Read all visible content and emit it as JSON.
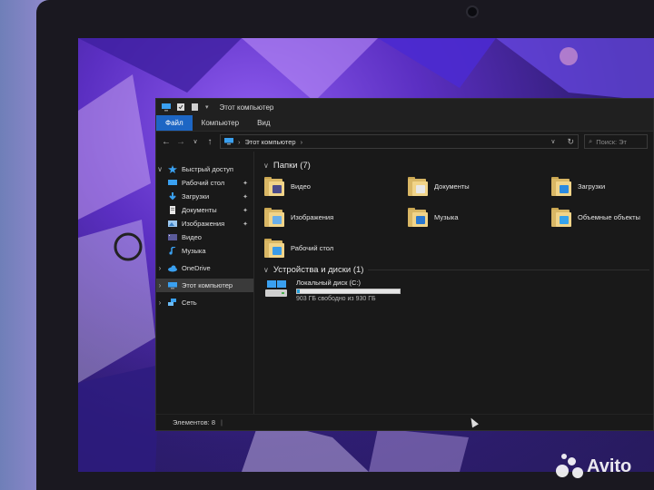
{
  "window": {
    "title": "Этот компьютер"
  },
  "ribbon": {
    "tabs": [
      "Файл",
      "Компьютер",
      "Вид"
    ],
    "active_tab": 0
  },
  "address": {
    "path": "Этот компьютер",
    "search_placeholder": "Поиск: Эт"
  },
  "nav": {
    "items": [
      {
        "label": "Быстрый доступ",
        "icon": "star-icon",
        "pinned": false
      },
      {
        "label": "Рабочий стол",
        "icon": "desktop-icon",
        "pinned": true
      },
      {
        "label": "Загрузки",
        "icon": "download-icon",
        "pinned": true
      },
      {
        "label": "Документы",
        "icon": "document-icon",
        "pinned": true
      },
      {
        "label": "Изображения",
        "icon": "pictures-icon",
        "pinned": true
      },
      {
        "label": "Видео",
        "icon": "video-icon",
        "pinned": false
      },
      {
        "label": "Музыка",
        "icon": "music-icon",
        "pinned": false
      },
      {
        "label": "OneDrive",
        "icon": "cloud-icon",
        "pinned": false
      },
      {
        "label": "Этот компьютер",
        "icon": "computer-icon",
        "pinned": false
      },
      {
        "label": "Сеть",
        "icon": "network-icon",
        "pinned": false
      }
    ]
  },
  "folders": {
    "header": "Папки (7)",
    "items": [
      {
        "label": "Видео",
        "icon": "video-folder-icon"
      },
      {
        "label": "Документы",
        "icon": "documents-folder-icon"
      },
      {
        "label": "Загрузки",
        "icon": "downloads-folder-icon"
      },
      {
        "label": "Изображения",
        "icon": "pictures-folder-icon"
      },
      {
        "label": "Музыка",
        "icon": "music-folder-icon"
      },
      {
        "label": "Объемные объекты",
        "icon": "3d-objects-folder-icon"
      },
      {
        "label": "Рабочий стол",
        "icon": "desktop-folder-icon"
      }
    ]
  },
  "devices": {
    "header": "Устройства и диски (1)",
    "drive": {
      "name": "Локальный диск (C:)",
      "free_text": "903 ГБ свободно из 930 ГБ",
      "used_fraction": 0.029
    }
  },
  "status": {
    "items_text": "Элементов: 8"
  },
  "watermark": {
    "text": "Avito"
  },
  "colors": {
    "accent": "#1d66c4",
    "drive_fill": "#26a0da"
  }
}
